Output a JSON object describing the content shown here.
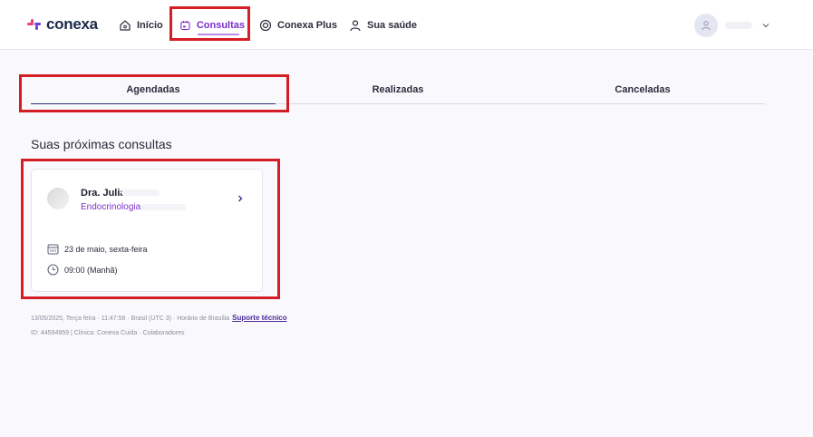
{
  "brand": {
    "name": "conexa"
  },
  "nav": {
    "items": [
      {
        "label": "Início",
        "icon": "home-icon"
      },
      {
        "label": "Consultas",
        "icon": "calendar-box-icon",
        "active": true
      },
      {
        "label": "Conexa Plus",
        "icon": "target-icon"
      },
      {
        "label": "Sua saúde",
        "icon": "person-icon"
      }
    ]
  },
  "tabs": [
    {
      "label": "Agendadas",
      "active": true
    },
    {
      "label": "Realizadas"
    },
    {
      "label": "Canceladas"
    }
  ],
  "section": {
    "title": "Suas próximas consultas"
  },
  "appointment": {
    "doctor": "Dra. Julia",
    "specialty": "Endocrinologia",
    "date": "23 de maio, sexta-feira",
    "time": "09:00 (Manhã)"
  },
  "footer": {
    "line1": "13/05/2025, Terça feira · 11:47:56 · Brasil (UTC 3) · Horário de Brasília",
    "support_link": "Suporte técnico",
    "line2": "ID: 44594959 | Clínica: Conexa Cuida · Colaboradores"
  },
  "colors": {
    "accent": "#7a2fc9",
    "highlight": "#d41d24",
    "brand_pink": "#e8417a"
  }
}
